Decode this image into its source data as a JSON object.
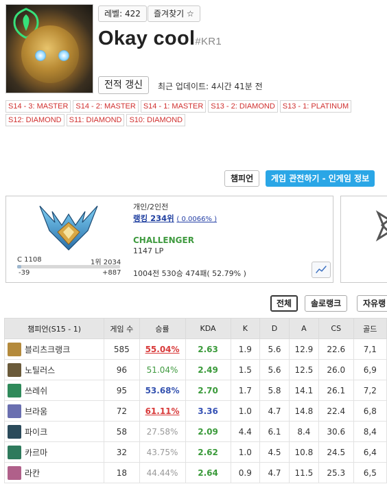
{
  "profile": {
    "level_label": "레벨: 422",
    "favorite_label": "즐겨찾기 ☆",
    "name": "Okay cool",
    "tag": "#KR1",
    "refresh_label": "전적 갱신",
    "last_update": "최근 업데이트: 4시간 41분 전"
  },
  "seasons": {
    "row1": [
      "S14 - 3: MASTER",
      "S14 - 2: MASTER",
      "S14 - 1: MASTER",
      "S13 - 2: DIAMOND",
      "S13 - 1: PLATINUM"
    ],
    "row2": [
      "S12: DIAMOND",
      "S11: DIAMOND",
      "S10: DIAMOND"
    ]
  },
  "tabs": {
    "champion_label": "챔피언",
    "spectate_label": "게임 관전하기 - 인게임 정보"
  },
  "rank": {
    "queue": "개인/2인전",
    "ranking_text": "랭킹 234위",
    "ranking_pct": "( 0.0066% )",
    "tier": "CHALLENGER",
    "lp": "1147 LP",
    "record": "1004전 530승 474패( 52.79% )",
    "cutoff_left_label": "C 1108",
    "cutoff_right_label": "1위 2034",
    "diff_left": "-39",
    "diff_right": "+887",
    "progress_fraction": 0.04
  },
  "filters": {
    "all": "전체",
    "solo": "솔로랭크",
    "flex": "자유랭"
  },
  "table": {
    "headers": [
      "챔피언(S15 - 1)",
      "게임 수",
      "승률",
      "KDA",
      "K",
      "D",
      "A",
      "CS",
      "골드"
    ],
    "rows": [
      {
        "name": "블리츠크랭크",
        "games": "585",
        "winrate": "55.04%",
        "wr_class": "wr-high",
        "kda": "2.63",
        "kda_class": "kda-green",
        "k": "1.9",
        "d": "5.6",
        "a": "12.9",
        "cs": "22.6",
        "gold": "7,1",
        "icon_color": "#b48a3c"
      },
      {
        "name": "노틸러스",
        "games": "96",
        "winrate": "51.04%",
        "wr_class": "wr-low",
        "kda": "2.49",
        "kda_class": "kda-green",
        "k": "1.5",
        "d": "5.6",
        "a": "12.5",
        "cs": "26.0",
        "gold": "6,9",
        "icon_color": "#6a5a3a"
      },
      {
        "name": "쓰레쉬",
        "games": "95",
        "winrate": "53.68%",
        "wr_class": "wr-mid",
        "kda": "2.70",
        "kda_class": "kda-green",
        "k": "1.7",
        "d": "5.8",
        "a": "14.1",
        "cs": "26.1",
        "gold": "7,2",
        "icon_color": "#2f8a5a"
      },
      {
        "name": "브라움",
        "games": "72",
        "winrate": "61.11%",
        "wr_class": "wr-high",
        "kda": "3.36",
        "kda_class": "kda-blue",
        "k": "1.0",
        "d": "4.7",
        "a": "14.8",
        "cs": "22.4",
        "gold": "6,8",
        "icon_color": "#6a6fb0"
      },
      {
        "name": "파이크",
        "games": "58",
        "winrate": "27.58%",
        "wr_class": "wr-vlow",
        "kda": "2.09",
        "kda_class": "kda-green",
        "k": "4.4",
        "d": "6.1",
        "a": "8.4",
        "cs": "30.6",
        "gold": "8,4",
        "icon_color": "#2a4a5a"
      },
      {
        "name": "카르마",
        "games": "32",
        "winrate": "43.75%",
        "wr_class": "wr-vlow",
        "kda": "2.62",
        "kda_class": "kda-green",
        "k": "1.0",
        "d": "4.5",
        "a": "10.8",
        "cs": "24.5",
        "gold": "6,4",
        "icon_color": "#2e7a5c"
      },
      {
        "name": "라칸",
        "games": "18",
        "winrate": "44.44%",
        "wr_class": "wr-vlow",
        "kda": "2.64",
        "kda_class": "kda-green",
        "k": "0.9",
        "d": "4.7",
        "a": "11.5",
        "cs": "25.3",
        "gold": "6,5",
        "icon_color": "#b0608a"
      }
    ]
  }
}
